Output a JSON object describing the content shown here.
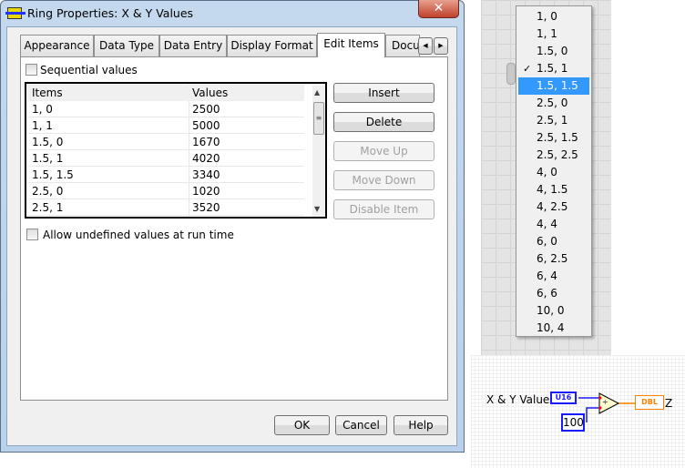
{
  "window": {
    "title": "Ring Properties: X & Y Values",
    "close_icon": "close-icon"
  },
  "tabs": [
    {
      "label": "Appearance"
    },
    {
      "label": "Data Type"
    },
    {
      "label": "Data Entry"
    },
    {
      "label": "Display Format"
    },
    {
      "label": "Edit Items",
      "active": true
    },
    {
      "label": "Docu"
    }
  ],
  "sequential": {
    "label": "Sequential values",
    "checked": false
  },
  "table": {
    "headers": [
      "Items",
      "Values"
    ],
    "rows": [
      [
        "1, 0",
        "2500"
      ],
      [
        "1, 1",
        "5000"
      ],
      [
        "1.5, 0",
        "1670"
      ],
      [
        "1.5, 1",
        "4020"
      ],
      [
        "1.5, 1.5",
        "3340"
      ],
      [
        "2.5, 0",
        "1020"
      ],
      [
        "2.5, 1",
        "3520"
      ]
    ]
  },
  "side_buttons": {
    "insert": "Insert",
    "delete": "Delete",
    "move_up": "Move Up",
    "move_down": "Move Down",
    "disable": "Disable Item"
  },
  "allow_undefined": {
    "label": "Allow undefined values at run time",
    "checked": false
  },
  "footer": {
    "ok": "OK",
    "cancel": "Cancel",
    "help": "Help"
  },
  "menu": {
    "items": [
      "1, 0",
      "1, 1",
      "1.5, 0",
      "1.5, 1",
      "1.5, 1.5",
      "2.5, 0",
      "2.5, 1",
      "2.5, 1.5",
      "2.5, 2.5",
      "4, 0",
      "4, 1.5",
      "4, 2.5",
      "4, 4",
      "6, 0",
      "6, 2.5",
      "6, 4",
      "6, 6",
      "10, 0",
      "10, 4"
    ],
    "checked": "1.5, 1",
    "highlighted": "1.5, 1.5",
    "highlight_color": "#3399ff"
  },
  "diagram": {
    "control_label": "X & Y Values",
    "control_type": "U16",
    "constant": "100",
    "operator": "÷",
    "indicator_type": "DBL",
    "indicator_label": "Z",
    "int_color": "#1a1aff",
    "dbl_color": "#ff8000"
  }
}
